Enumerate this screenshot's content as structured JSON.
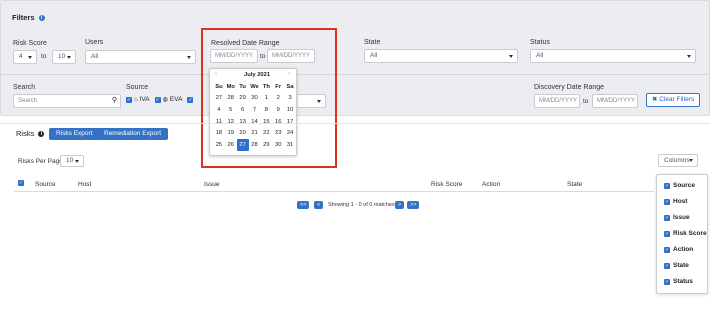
{
  "filters": {
    "title": "Filters",
    "risk_score": {
      "label": "Risk Score",
      "min": "4",
      "max": "10",
      "to": "to"
    },
    "users": {
      "label": "Users",
      "value": "All"
    },
    "resolved_date_range": {
      "label": "Resolved Date Range",
      "from_placeholder": "MM/DD/YYYY",
      "to_placeholder": "MM/DD/YYYY",
      "to": "to"
    },
    "state": {
      "label": "State",
      "value": "All"
    },
    "status": {
      "label": "Status",
      "value": "All"
    },
    "search": {
      "label": "Search",
      "placeholder": "Search"
    },
    "source": {
      "label": "Source",
      "items": [
        "IVA",
        "EVA"
      ]
    },
    "discovery_date_range": {
      "label": "Discovery Date Range",
      "from_placeholder": "MM/DD/YYYY",
      "to_placeholder": "MM/DD/YYYY",
      "to": "to"
    },
    "clear_label": "Clear Filters"
  },
  "calendar": {
    "month": "July 2021",
    "prev": "‹",
    "next": "›",
    "weekdays": [
      "Su",
      "Mo",
      "Tu",
      "We",
      "Th",
      "Fr",
      "Sa"
    ],
    "weeks": [
      [
        "27",
        "28",
        "29",
        "30",
        "1",
        "2",
        "3"
      ],
      [
        "4",
        "5",
        "6",
        "7",
        "8",
        "9",
        "10"
      ],
      [
        "11",
        "12",
        "13",
        "14",
        "15",
        "16",
        "17"
      ],
      [
        "18",
        "19",
        "20",
        "21",
        "22",
        "23",
        "24"
      ],
      [
        "25",
        "26",
        "27",
        "28",
        "29",
        "30",
        "31"
      ]
    ],
    "selected": "27"
  },
  "risks": {
    "title": "Risks",
    "export_label": "Risks Export",
    "remediation_export_label": "Remediation Export",
    "per_page_label": "Risks Per Page",
    "per_page_value": "10",
    "columns_label": "Columns",
    "headers": [
      "Source",
      "Host",
      "Issue",
      "Risk Score",
      "Action",
      "State"
    ],
    "pagination": {
      "first": "<<",
      "prev": "<",
      "info": "Showing 1 - 0 of 0 matches",
      "next": ">",
      "last": ">>"
    }
  },
  "column_menu": {
    "items": [
      "Source",
      "Host",
      "Issue",
      "Risk Score",
      "Action",
      "State",
      "Status"
    ]
  },
  "colors": {
    "accent": "#3472c6",
    "highlight": "#e0301e"
  }
}
